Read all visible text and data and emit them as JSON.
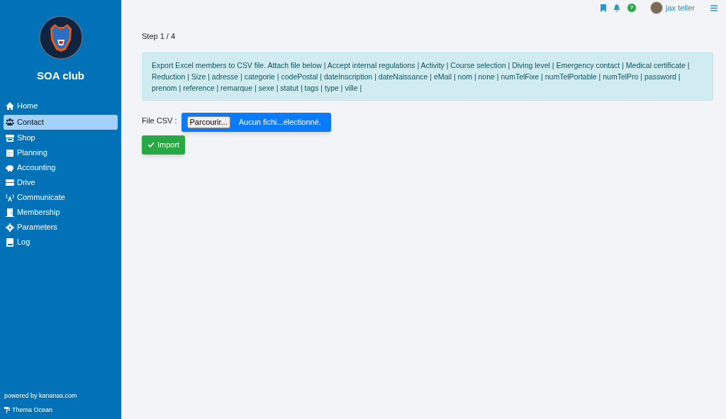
{
  "sidebar": {
    "club_name": "SOA club",
    "items": [
      {
        "label": "Home",
        "selected": false
      },
      {
        "label": "Contact",
        "selected": true
      },
      {
        "label": "Shop",
        "selected": false
      },
      {
        "label": "Planning",
        "selected": false
      },
      {
        "label": "Accounting",
        "selected": false
      },
      {
        "label": "Drive",
        "selected": false
      },
      {
        "label": "Communicate",
        "selected": false
      },
      {
        "label": "Membership",
        "selected": false
      },
      {
        "label": "Parameters",
        "selected": false
      },
      {
        "label": "Log",
        "selected": false
      }
    ],
    "footer": {
      "powered_by": "powered by kananas.com",
      "theme": "Thema Ocean"
    }
  },
  "topbar": {
    "help": "?",
    "user": "jax teller"
  },
  "step": "Step 1 / 4",
  "info": "Export Excel members to CSV file. Attach file below | Accept internal regulations | Activity | Course selection | Diving level | Emergency contact | Medical certificate | Reduction | Size | adresse | categorie | codePostal | dateInscription | dateNaissance | eMail | nom | none | numTelFixe | numTelPortable | numTelPro | password | prenom | reference | remarque | sexe | statut | tags | type | ville |",
  "file_field": {
    "label": "File CSV :",
    "button": "Parcourir...",
    "value": "Aucun fichi...électionné."
  },
  "import_button": "Import"
}
